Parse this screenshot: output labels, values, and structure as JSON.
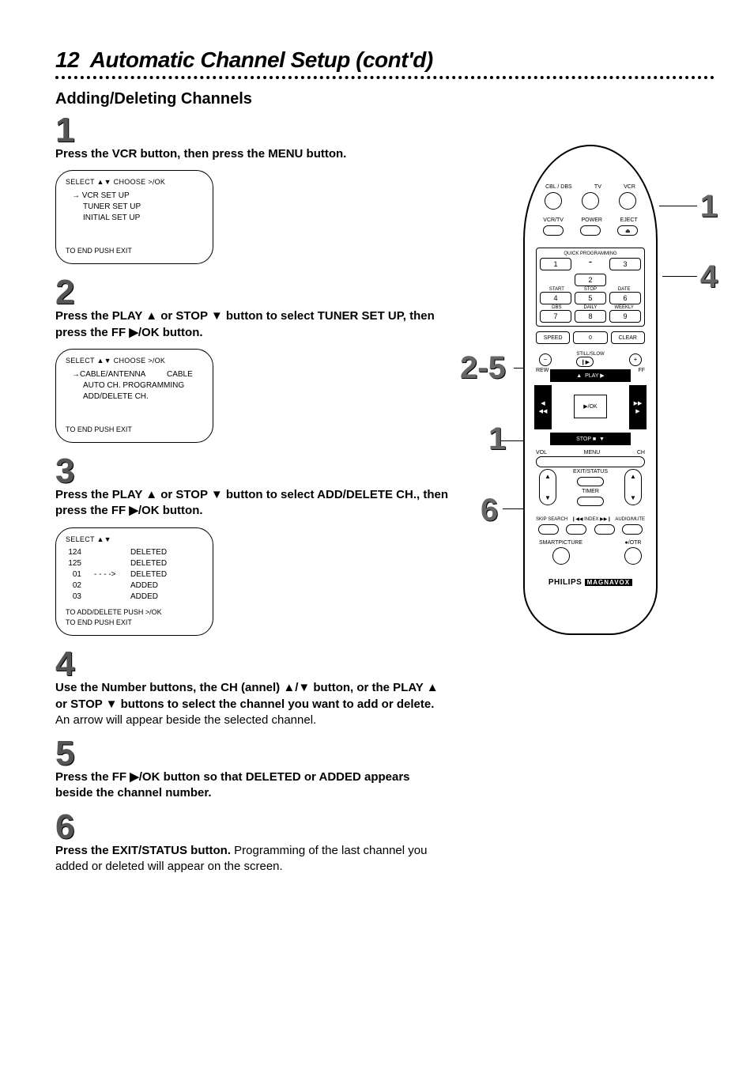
{
  "page": {
    "number": "12",
    "title": "Automatic Channel Setup (cont'd)",
    "subtitle": "Adding/Deleting Channels"
  },
  "steps": {
    "s1": {
      "num": "1",
      "bold": "Press the VCR button, then press the MENU button."
    },
    "s2": {
      "num": "2",
      "bold": "Press the PLAY ▲ or STOP ▼ button to select TUNER SET UP, then press the FF ▶/OK button."
    },
    "s3": {
      "num": "3",
      "bold": "Press the PLAY ▲ or STOP ▼ button to select ADD/DELETE CH., then press the FF ▶/OK button."
    },
    "s4": {
      "num": "4",
      "bold": "Use the Number buttons, the CH (annel) ▲/▼ button, or the PLAY ▲ or STOP ▼ buttons to select the channel you want to add or delete.",
      "rest": " An arrow will appear beside the selected channel."
    },
    "s5": {
      "num": "5",
      "bold": "Press the FF ▶/OK button so that  DELETED or ADDED appears beside the channel number."
    },
    "s6": {
      "num": "6",
      "bold": "Press the EXIT/STATUS button.",
      "rest": " Programming of the last channel you added or deleted will appear on the screen."
    }
  },
  "osd1": {
    "head": "SELECT ▲▼          CHOOSE >/OK",
    "i1": "VCR SET UP",
    "i2": "TUNER SET UP",
    "i3": "INITIAL SET UP",
    "foot": "TO END PUSH EXIT"
  },
  "osd2": {
    "head": "SELECT ▲▼          CHOOSE >/OK",
    "r1l": "CABLE/ANTENNA",
    "r1r": "CABLE",
    "r2": "AUTO CH. PROGRAMMING",
    "r3": "ADD/DELETE CH.",
    "foot": "TO END PUSH EXIT"
  },
  "osd3": {
    "head": "SELECT ▲▼",
    "rows": [
      {
        "n": "124",
        "m": "",
        "s": "DELETED"
      },
      {
        "n": "125",
        "m": "",
        "s": "DELETED"
      },
      {
        "n": "01",
        "m": "- - - ->",
        "s": "DELETED"
      },
      {
        "n": "02",
        "m": "",
        "s": "ADDED"
      },
      {
        "n": "03",
        "m": "",
        "s": "ADDED"
      }
    ],
    "foot1": "TO ADD/DELETE  PUSH >/OK",
    "foot2": "TO END PUSH EXIT"
  },
  "callouts": {
    "c1": "1",
    "c25": "2-5",
    "c4": "4",
    "c1b": "1",
    "c6": "6"
  },
  "remote": {
    "top_labels": {
      "a": "CBL / DBS",
      "b": "TV",
      "c": "VCR"
    },
    "mid_labels": {
      "a": "VCR/TV",
      "b": "POWER",
      "c": "EJECT"
    },
    "eject": "⏏",
    "keypad": {
      "title": "QUICK PROGRAMMING",
      "k1": "1",
      "k2": "2",
      "k3": "3",
      "s1": "START",
      "s2": "STOP",
      "s3": "DATE",
      "k4": "4",
      "k5": "5",
      "k6": "6",
      "s4": "DBS",
      "s5": "DAILY",
      "s6": "WEEKLY",
      "k7": "7",
      "k8": "8",
      "k9": "9"
    },
    "speed": {
      "a": "SPEED",
      "b": "0",
      "c": "CLEAR"
    },
    "slow": {
      "label": "STILL/SLOW",
      "minus": "−",
      "play": "❙▶",
      "plus": "+"
    },
    "nav": {
      "rew": "REW",
      "ff": "FF",
      "up": "▲",
      "down": "▼",
      "left": "◀◀",
      "right": "▶▶",
      "playlbl": "PLAY ▶",
      "stoplbl": "STOP ■",
      "ok": "▶/OK"
    },
    "menu": {
      "vol": "VOL",
      "menu": "MENU",
      "ch": "CH"
    },
    "rockers": {
      "u": "▲",
      "d": "▼",
      "exit": "EXIT/STATUS",
      "timer": "TIMER"
    },
    "skip": {
      "a": "SKIP SEARCH",
      "b": "❙◀◀ INDEX ▶▶❙",
      "c": "AUDIO/MUTE"
    },
    "bottom": {
      "a": "SMARTPICTURE",
      "b": "●/OTR"
    },
    "brand": {
      "a": "PHILIPS",
      "b": "MAGNAVOX"
    }
  }
}
